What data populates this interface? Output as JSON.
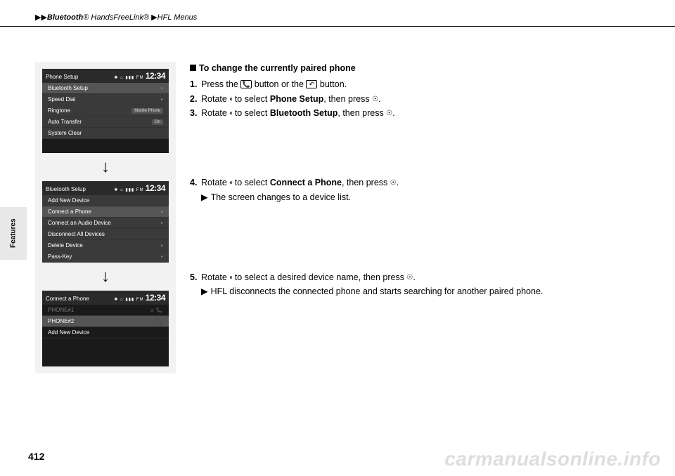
{
  "header": {
    "breadcrumb_1": "Bluetooth",
    "breadcrumb_1_reg": "®",
    "breadcrumb_2": " HandsFreeLink® ",
    "breadcrumb_3": "HFL Menus"
  },
  "side_tab": "Features",
  "page_number": "412",
  "watermark": "carmanualsonline.info",
  "screens": {
    "clock": "12:34",
    "status_icons": "✱ ⌂ ▮▮▮ FM",
    "s1": {
      "title": "Phone Setup",
      "rows": [
        "Bluetooth Setup",
        "Speed Dial",
        "Ringtone",
        "Auto Transfer",
        "System Clear"
      ],
      "ringtone_val": "Mobile Phone",
      "auto_val": "On"
    },
    "s2": {
      "title": "Bluetooth Setup",
      "rows": [
        "Add New Device",
        "Connect a Phone",
        "Connect an Audio Device",
        "Disconnect All Devices",
        "Delete Device",
        "Pass-Key"
      ]
    },
    "s3": {
      "title": "Connect a Phone",
      "rows": [
        "PHONE#1",
        "PHONE#2",
        "Add New Device"
      ]
    }
  },
  "instructions": {
    "title": "To change the currently paired phone",
    "step1_a": "Press the ",
    "step1_b": " button or the ",
    "step1_c": " button.",
    "step2_a": "Rotate ",
    "step2_b": " to select ",
    "step2_bold": "Phone Setup",
    "step2_c": ", then press ",
    "step2_d": ".",
    "step3_a": "Rotate ",
    "step3_b": " to select ",
    "step3_bold": "Bluetooth Setup",
    "step3_c": ", then press ",
    "step3_d": ".",
    "step4_a": "Rotate ",
    "step4_b": " to select ",
    "step4_bold": "Connect a Phone",
    "step4_c": ", then press ",
    "step4_d": ".",
    "step4_sub": "The screen changes to a device list.",
    "step5_a": "Rotate ",
    "step5_b": " to select a desired device name, then press ",
    "step5_c": ".",
    "step5_sub": "HFL disconnects the connected phone and starts searching for another paired phone."
  }
}
